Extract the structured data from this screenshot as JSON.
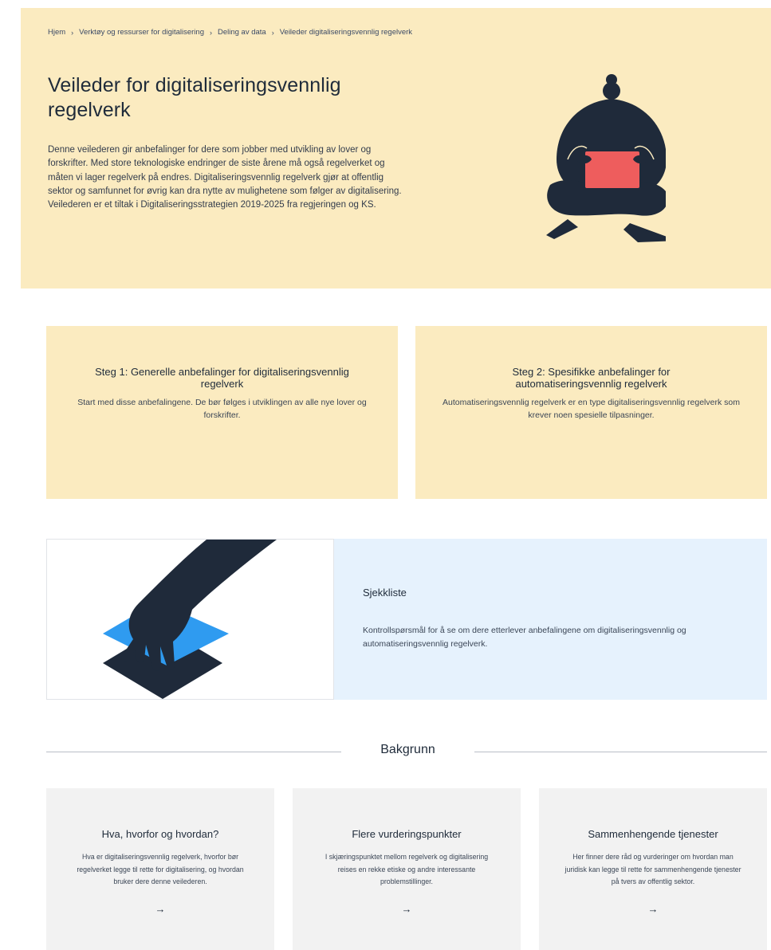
{
  "breadcrumb": {
    "items": [
      "Hjem",
      "Verktøy og ressurser for digitalisering",
      "Deling av data",
      "Veileder digitaliseringsvennlig regelverk"
    ],
    "separator": "›"
  },
  "hero": {
    "title": "Veileder for digitaliseringsvennlig regelverk",
    "lead": "Denne veilederen gir anbefalinger for dere som jobber med utvikling av lover og forskrifter. Med store teknologiske endringer de siste årene må også regelverket og måten vi lager regelverk på endres. Digitaliseringsvennlig regelverk gjør at offentlig sektor og samfunnet for øvrig kan dra nytte av mulighetene som følger av digitalisering. Veilederen er et tiltak i Digitaliseringsstrategien 2019-2025 fra regjeringen og KS."
  },
  "steps": [
    {
      "title": "Steg 1: Generelle anbefalinger for digitaliseringsvennlig regelverk",
      "text": "Start med disse anbefalingene. De bør følges i utviklingen av alle nye lover og forskrifter."
    },
    {
      "title": "Steg 2: Spesifikke anbefalinger for automatiseringsvennlig regelverk",
      "text": "Automatiseringsvennlig regelverk er en type digitaliseringsvennlig regelverk som krever noen spesielle tilpasninger."
    }
  ],
  "checklist": {
    "title": "Sjekkliste",
    "text": "Kontrollspørsmål for å se om dere etterlever anbefalingene om digitaliseringsvennlig og automatiseringsvennlig regelverk."
  },
  "background": {
    "heading": "Bakgrunn",
    "cards": [
      {
        "title": "Hva, hvorfor og hvordan?",
        "text": "Hva er digitaliseringsvennlig regelverk, hvorfor bør regelverket legge til rette for digitalisering, og hvordan bruker dere denne veilederen.",
        "arrow": "→"
      },
      {
        "title": "Flere vurderingspunkter",
        "text": "I skjæringspunktet mellom regelverk og digitalisering reises en rekke etiske og andre interessante problemstillinger.",
        "arrow": "→"
      },
      {
        "title": "Sammenhengende tjenester",
        "text": "Her finner dere råd og vurderinger om hvordan man juridisk kan legge til rette for sammenhengende tjenester på tvers av offentlig sektor.",
        "arrow": "→"
      }
    ]
  },
  "colors": {
    "hero_bg": "#fbebc0",
    "checklist_bg": "#e6f2fd",
    "card_bg": "#f2f2f2",
    "figure_dark": "#1f2a3a",
    "laptop_red": "#ee5d5d",
    "paper_blue": "#2f9bf0"
  }
}
